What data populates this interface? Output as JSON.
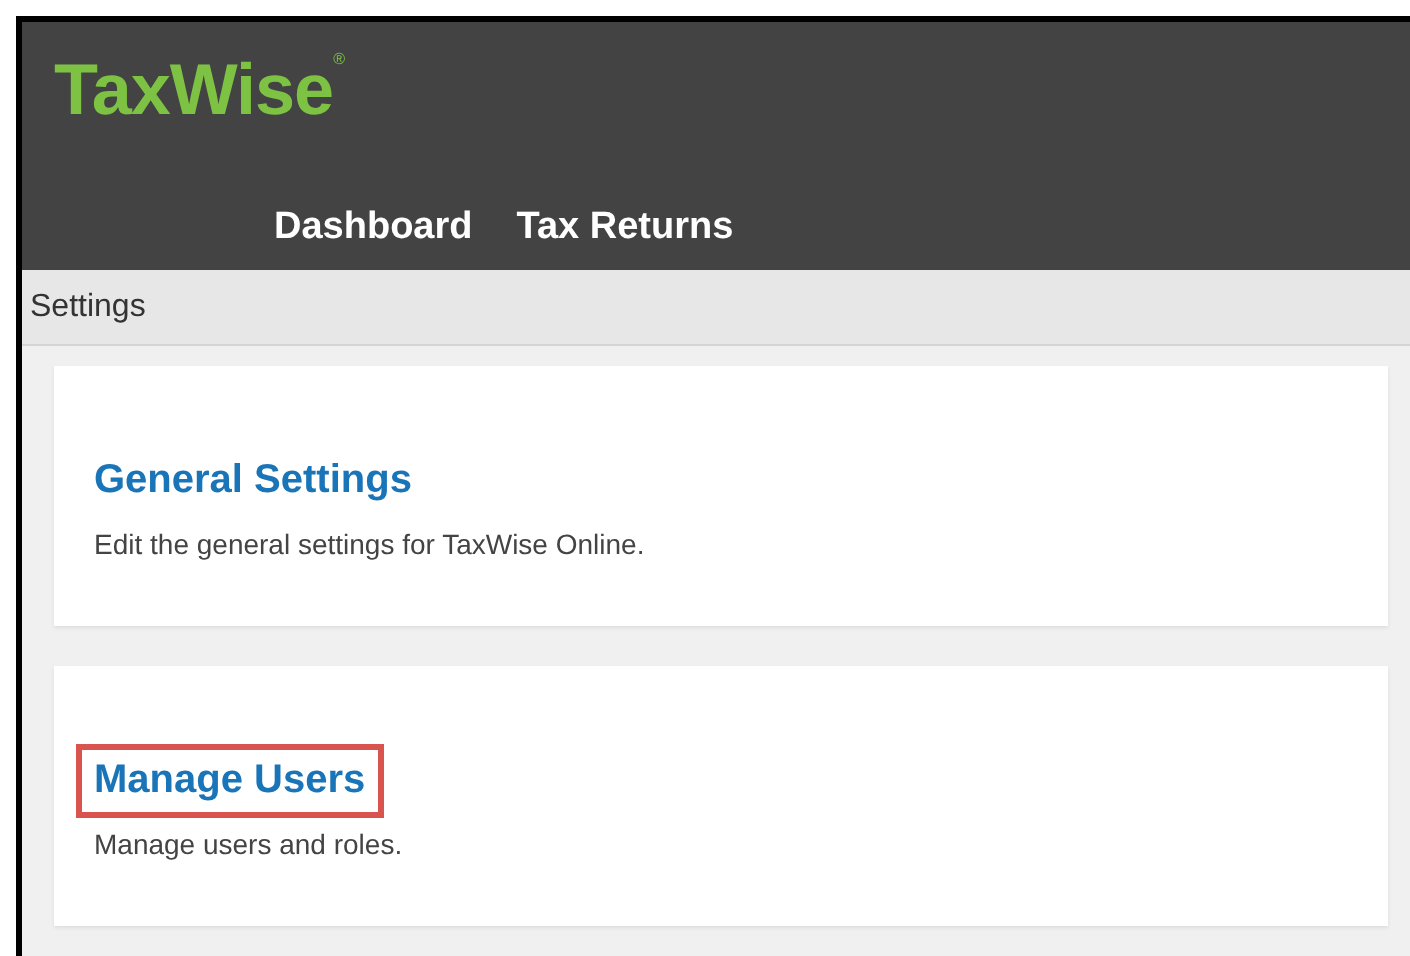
{
  "header": {
    "logo": "TaxWise",
    "logo_mark": "®",
    "nav": [
      {
        "label": "Dashboard",
        "selected": false
      },
      {
        "label": "Tax Returns",
        "selected": false
      }
    ]
  },
  "breadcrumb": "Settings",
  "cards": [
    {
      "title": "General Settings",
      "description": "Edit the general settings for TaxWise Online.",
      "highlighted": false
    },
    {
      "title": "Manage Users",
      "description": "Manage users and roles.",
      "highlighted": true
    }
  ]
}
